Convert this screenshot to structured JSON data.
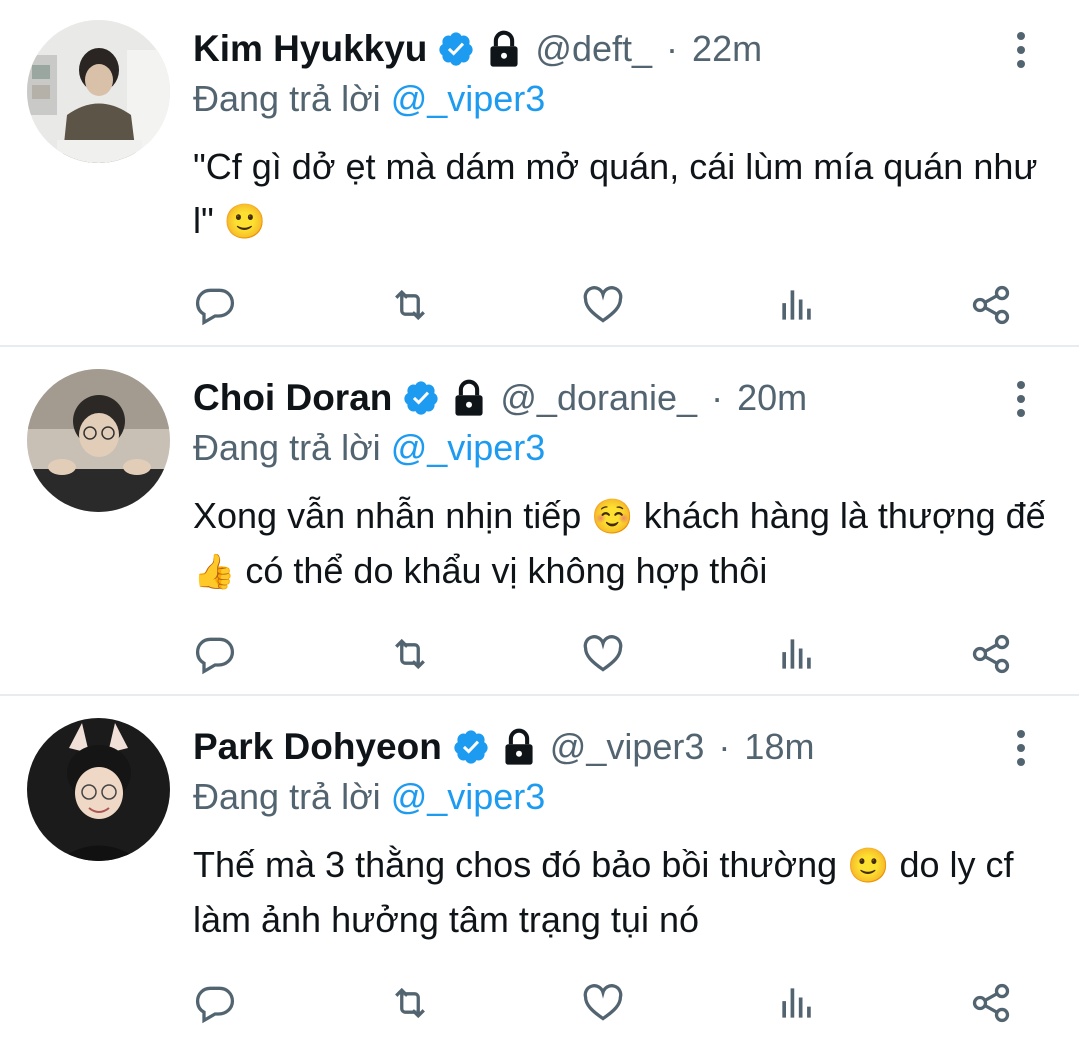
{
  "reply_prefix": "Đang trả lời",
  "tweets": [
    {
      "name": "Kim Hyukkyu",
      "handle": "@deft_",
      "time": "22m",
      "reply_to": "@_viper3",
      "text": "\"Cf gì dở ẹt mà dám mở quán, cái lùm mía quán như l\"",
      "emoji": "🙂"
    },
    {
      "name": "Choi Doran",
      "handle": "@_doranie_",
      "time": "20m",
      "reply_to": "@_viper3",
      "text_parts": [
        "Xong vẫn nhẫn nhịn tiếp",
        "☺️",
        "khách hàng là thượng đế",
        "👍",
        "có thể do khẩu vị không hợp thôi"
      ]
    },
    {
      "name": "Park Dohyeon",
      "handle": "@_viper3",
      "time": "18m",
      "reply_to": "@_viper3",
      "text_parts": [
        "Thế mà 3 thằng chos đó bảo bồi thường",
        "🙂",
        "do ly cf làm ảnh hưởng tâm trạng tụi nó"
      ]
    }
  ],
  "colors": {
    "accent": "#1d9bf0",
    "muted": "#536471",
    "text": "#0f1419",
    "divider": "#e6ecf0"
  },
  "icons": [
    "verified-icon",
    "lock-icon",
    "more-icon",
    "reply-icon",
    "retweet-icon",
    "like-icon",
    "views-icon",
    "share-icon"
  ]
}
